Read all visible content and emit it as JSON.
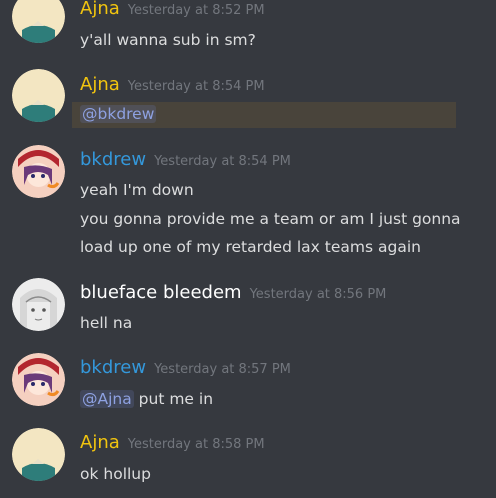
{
  "messages": [
    {
      "author": "Ajna",
      "timestamp": "Yesterday at 8:52 PM",
      "lines": [
        "y'all wanna sub in sm?"
      ]
    },
    {
      "author": "Ajna",
      "timestamp": "Yesterday at 8:54 PM",
      "mention": "@bkdrew"
    },
    {
      "author": "bkdrew",
      "timestamp": "Yesterday at 8:54 PM",
      "lines": [
        "yeah I'm down",
        "you gonna provide me a team or am I just gonna",
        "load up one of my retarded lax teams again"
      ]
    },
    {
      "author": "blueface bleedem",
      "timestamp": "Yesterday at 8:56 PM",
      "lines": [
        "hell na"
      ]
    },
    {
      "author": "bkdrew",
      "timestamp": "Yesterday at 8:57 PM",
      "mention": "@Ajna",
      "after_mention": " put me in"
    },
    {
      "author": "Ajna",
      "timestamp": "Yesterday at 8:58 PM",
      "lines": [
        "ok hollup"
      ]
    }
  ],
  "colors": {
    "ajna": "#f1c40f",
    "bkdrew": "#3498db",
    "blueface": "#ffffff",
    "background": "#36393f"
  }
}
